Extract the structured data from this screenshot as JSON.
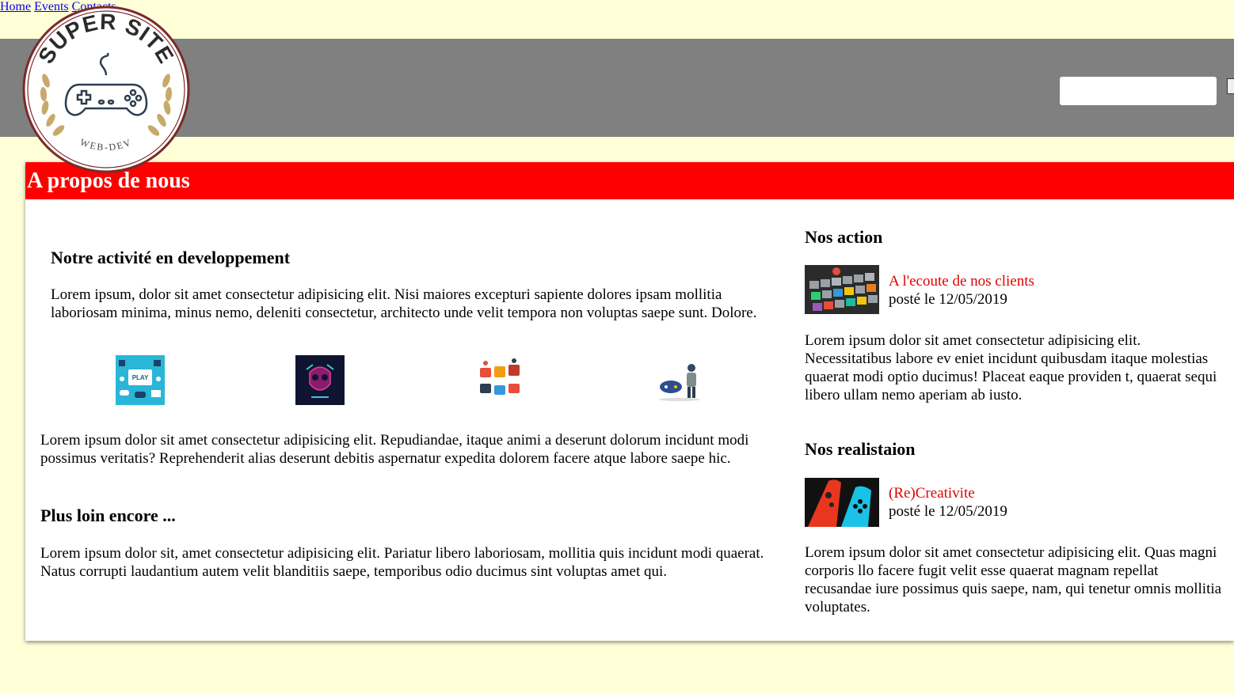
{
  "logo": {
    "top_text": "SUPER SITE",
    "bottom_text": "WEB-DEV"
  },
  "nav": {
    "items": [
      {
        "label": "Home"
      },
      {
        "label": "Events"
      },
      {
        "label": "Contacts"
      }
    ]
  },
  "search": {
    "placeholder": "",
    "value": ""
  },
  "colors": {
    "accent": "#ff0000",
    "header": "#808080",
    "background": "#ffffd8",
    "link": "#e00000"
  },
  "about": {
    "title": "A propos de nous",
    "activity": {
      "heading": "Notre activité en developpement",
      "text": "Lorem ipsum, dolor sit amet consectetur adipisicing elit. Nisi maiores excepturi sapiente dolores ipsam mollitia laboriosam minima, minus nemo, deleniti consectetur, architecto unde velit tempora non voluptas saepe sunt. Dolore."
    },
    "gallery": [
      {
        "icon": "play-console-icon"
      },
      {
        "icon": "neon-skull-icon"
      },
      {
        "icon": "arcade-controllers-icon"
      },
      {
        "icon": "gamer-with-gamepad-icon"
      }
    ],
    "text2": "Lorem ipsum dolor sit amet consectetur adipisicing elit. Repudiandae, itaque animi a deserunt dolorum incidunt modi possimus veritatis? Reprehenderit alias deserunt debitis aspernatur expedita dolorem facere atque labore saepe hic.",
    "further": {
      "heading": "Plus loin encore ...",
      "text": "Lorem ipsum dolor sit, amet consectetur adipisicing elit. Pariatur libero laboriosam, mollitia quis incidunt modi quaerat. Natus corrupti laudantium autem velit blanditiis saepe, temporibus odio ducimus sint voluptas amet qui."
    }
  },
  "actions": {
    "title": "Nos action",
    "post": {
      "link": "A l'ecoute de nos clients",
      "date": "posté le 12/05/2019",
      "image": "keyboard-keys-icon",
      "text": "Lorem ipsum dolor sit amet consectetur adipisicing elit. Necessitatibus labore ev eniet incidunt quibusdam itaque molestias quaerat modi optio ducimus! Placeat eaque providen t, quaerat sequi libero ullam nemo aperiam ab iusto."
    }
  },
  "realisations": {
    "title": "Nos realistaion",
    "post": {
      "link": "(Re)Creativite",
      "date": "posté le 12/05/2019",
      "image": "joycon-controllers-icon",
      "text": "Lorem ipsum dolor sit amet consectetur adipisicing elit. Quas magni corporis llo facere fugit velit esse quaerat magnam repellat recusandae iure possimus quis saepe, nam, qui tenetur omnis mollitia voluptates."
    }
  }
}
